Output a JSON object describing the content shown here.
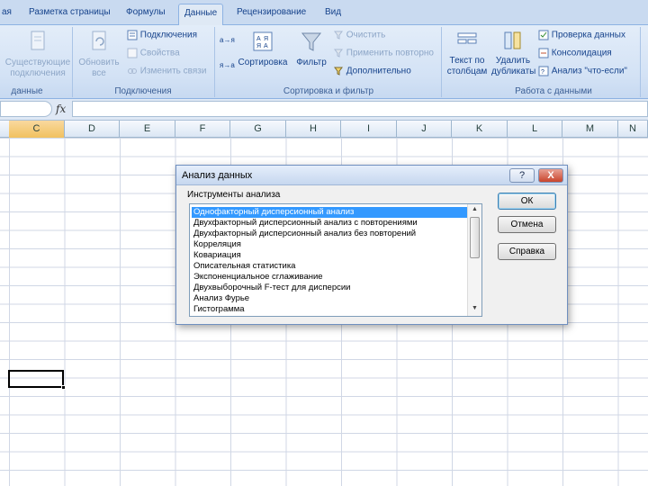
{
  "tabs": [
    {
      "label": "ая",
      "active": false
    },
    {
      "label": "Разметка страницы",
      "active": false
    },
    {
      "label": "Формулы",
      "active": false
    },
    {
      "label": "Данные",
      "active": true
    },
    {
      "label": "Рецензирование",
      "active": false
    },
    {
      "label": "Вид",
      "active": false
    }
  ],
  "ribbon": {
    "existing_connections": "Существующие подключения",
    "refresh_all": "Обновить все",
    "connections": "Подключения",
    "properties": "Свойства",
    "edit_links": "Изменить связи",
    "sort_asc_icon": "а→я",
    "sort_desc_icon": "я→а",
    "sort": "Сортировка",
    "filter": "Фильтр",
    "clear": "Очистить",
    "reapply": "Применить повторно",
    "advanced": "Дополнительно",
    "text_to_columns": "Текст по столбцам",
    "remove_duplicates": "Удалить дубликаты",
    "data_validation": "Проверка данных",
    "consolidate": "Консолидация",
    "what_if": "Анализ \"что-если\"",
    "group_get_data": "данные",
    "group_connections": "Подключения",
    "group_sort_filter": "Сортировка и фильтр",
    "group_data_tools": "Работа с данными"
  },
  "formula_bar": {
    "fx": "fx",
    "value": ""
  },
  "columns": [
    "C",
    "D",
    "E",
    "F",
    "G",
    "H",
    "I",
    "J",
    "K",
    "L",
    "M",
    "N"
  ],
  "selected_column": "C",
  "dialog": {
    "title": "Анализ данных",
    "help_btn": "?",
    "close_btn": "X",
    "list_label": "Инструменты анализа",
    "tools": [
      "Однофакторный дисперсионный анализ",
      "Двухфакторный дисперсионный анализ с повторениями",
      "Двухфакторный дисперсионный анализ без повторений",
      "Корреляция",
      "Ковариация",
      "Описательная статистика",
      "Экспоненциальное сглаживание",
      "Двухвыборочный F-тест для дисперсии",
      "Анализ Фурье",
      "Гистограмма"
    ],
    "selected_index": 0,
    "ok": "ОК",
    "cancel": "Отмена",
    "help": "Справка"
  },
  "colors": {
    "ribbon": "#d3e2f5",
    "selection": "#3399ff",
    "header_selected": "#f1c15f"
  }
}
